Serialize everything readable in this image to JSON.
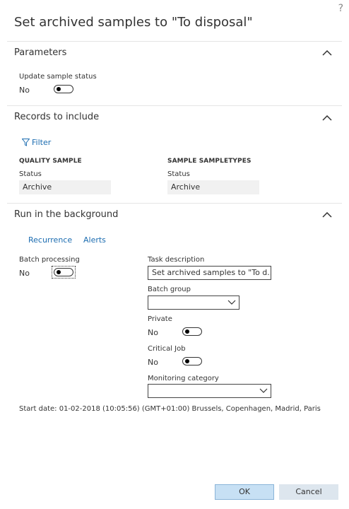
{
  "dialog": {
    "help_glyph": "?",
    "title": "Set archived samples to \"To disposal\""
  },
  "parameters": {
    "heading": "Parameters",
    "update_status_label": "Update sample status",
    "update_status_value": "No"
  },
  "records": {
    "heading": "Records to include",
    "filter_label": "Filter",
    "col1_header": "QUALITY SAMPLE",
    "col1_status_label": "Status",
    "col1_status_value": "Archive",
    "col2_header": "SAMPLE SAMPLETYPES",
    "col2_status_label": "Status",
    "col2_status_value": "Archive"
  },
  "background": {
    "heading": "Run in the background",
    "recurrence_label": "Recurrence",
    "alerts_label": "Alerts",
    "batch_label": "Batch processing",
    "batch_value": "No",
    "task_label": "Task description",
    "task_value": "Set archived samples to \"To d...",
    "batch_group_label": "Batch group",
    "batch_group_value": "",
    "private_label": "Private",
    "private_value": "No",
    "critical_label": "Critical Job",
    "critical_value": "No",
    "monitoring_label": "Monitoring category",
    "monitoring_value": "",
    "start_date": "Start date: 01-02-2018 (10:05:56) (GMT+01:00) Brussels, Copenhagen, Madrid, Paris"
  },
  "footer": {
    "ok_label": "OK",
    "cancel_label": "Cancel"
  },
  "colors": {
    "link": "#1b6cb0",
    "ok_button": "#c7e0f4",
    "cancel_button": "#dde6ee"
  }
}
